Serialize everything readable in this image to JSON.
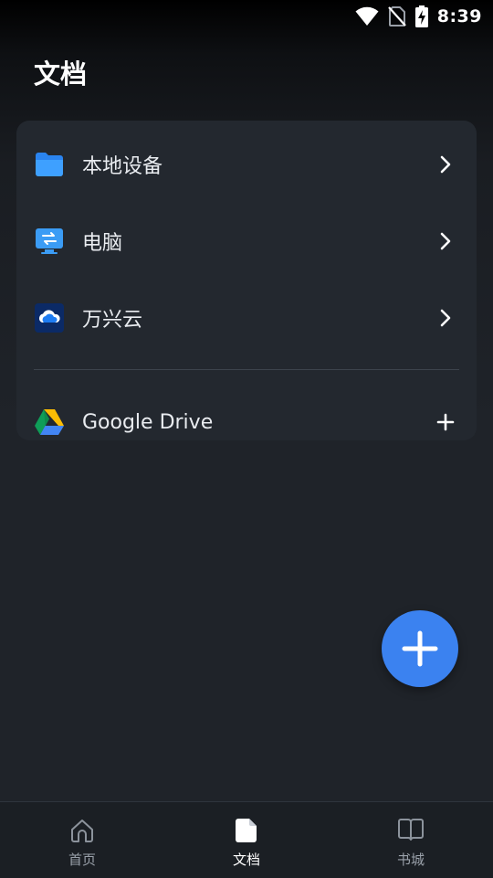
{
  "status_bar": {
    "time": "8:39",
    "icons": [
      "wifi-icon",
      "no-sim-icon",
      "battery-charging-icon"
    ]
  },
  "page": {
    "title": "文档"
  },
  "locations": [
    {
      "label": "本地设备",
      "icon": "folder-icon",
      "action": "chevron-right-icon"
    },
    {
      "label": "电脑",
      "icon": "computer-transfer-icon",
      "action": "chevron-right-icon"
    },
    {
      "label": "万兴云",
      "icon": "wondershare-cloud-icon",
      "action": "chevron-right-icon"
    }
  ],
  "cloud_services": [
    {
      "label": "Google Drive",
      "icon": "google-drive-icon",
      "action": "plus-icon"
    }
  ],
  "fab": {
    "icon": "plus-icon"
  },
  "bottom_nav": {
    "items": [
      {
        "label": "首页",
        "icon": "home-icon",
        "active": false
      },
      {
        "label": "文档",
        "icon": "document-icon",
        "active": true
      },
      {
        "label": "书城",
        "icon": "book-icon",
        "active": false
      }
    ]
  },
  "colors": {
    "accent": "#3b82f0",
    "background": "#1f2329",
    "card": "#23282f"
  }
}
